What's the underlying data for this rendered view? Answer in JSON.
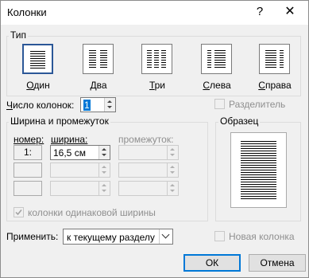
{
  "window": {
    "title": "Колонки",
    "help": "?",
    "close": "✕"
  },
  "type_group": {
    "label": "Тип",
    "presets": [
      {
        "label": "Один",
        "columns": 1,
        "selected": true
      },
      {
        "label": "Два",
        "columns": 2,
        "selected": false
      },
      {
        "label": "Три",
        "columns": 3,
        "selected": false
      },
      {
        "label": "Слева",
        "columns": "left",
        "selected": false
      },
      {
        "label": "Справа",
        "columns": "right",
        "selected": false
      }
    ]
  },
  "num_columns": {
    "label": "Число колонок:",
    "value": "1"
  },
  "separator": {
    "label": "Разделитель",
    "checked": false,
    "enabled": false
  },
  "width_group": {
    "label": "Ширина и промежуток",
    "headers": {
      "number": "номер:",
      "width": "ширина:",
      "spacing": "промежуток:"
    },
    "rows": [
      {
        "number": "1:",
        "width": "16,5 см",
        "spacing": ""
      },
      {
        "number": "",
        "width": "",
        "spacing": ""
      },
      {
        "number": "",
        "width": "",
        "spacing": ""
      }
    ]
  },
  "equal_width": {
    "label": "колонки одинаковой ширины",
    "checked": true,
    "enabled": false
  },
  "preview": {
    "label": "Образец"
  },
  "apply": {
    "label": "Применить:",
    "value": "к текущему разделу"
  },
  "new_column": {
    "label": "Новая колонка",
    "checked": false,
    "enabled": false
  },
  "buttons": {
    "ok": "ОК",
    "cancel": "Отмена"
  },
  "colors": {
    "accent": "#0078d7",
    "selected_border": "#2b5797"
  }
}
